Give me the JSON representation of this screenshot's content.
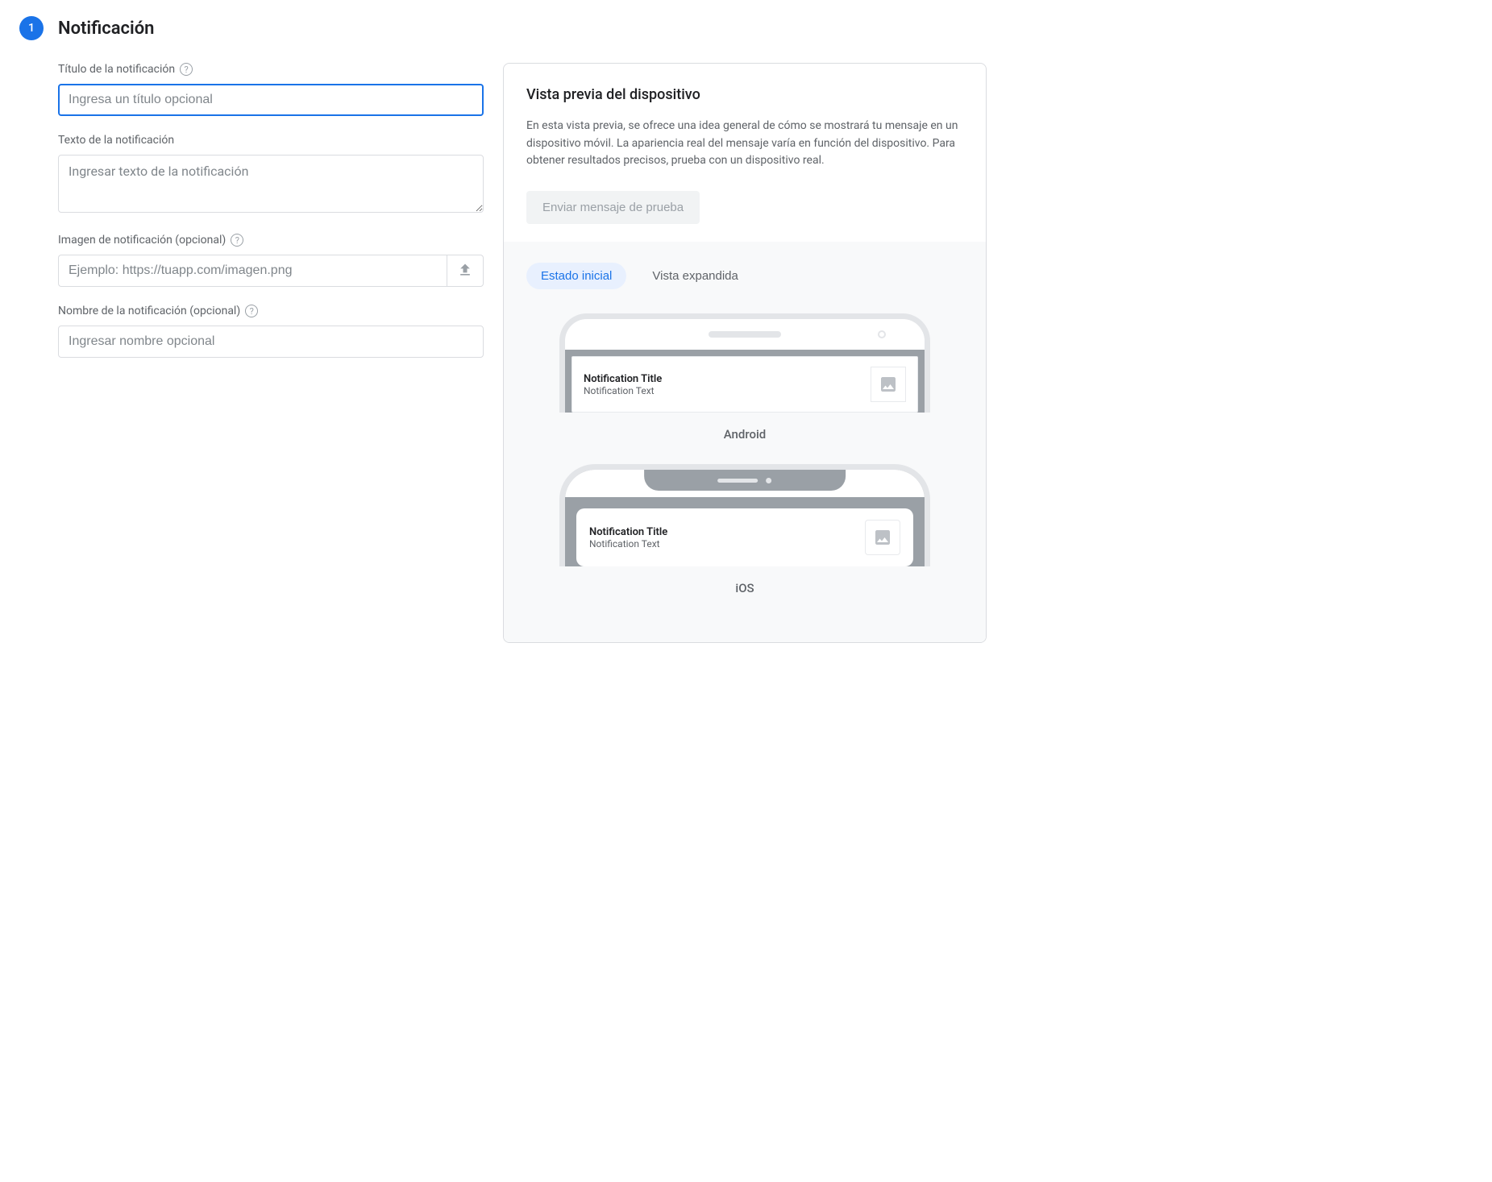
{
  "step": {
    "number": "1",
    "title": "Notificación"
  },
  "fields": {
    "title": {
      "label": "Título de la notificación",
      "placeholder": "Ingresa un título opcional"
    },
    "text": {
      "label": "Texto de la notificación",
      "placeholder": "Ingresar texto de la notificación"
    },
    "image": {
      "label": "Imagen de notificación (opcional)",
      "placeholder": "Ejemplo: https://tuapp.com/imagen.png"
    },
    "name": {
      "label": "Nombre de la notificación (opcional)",
      "placeholder": "Ingresar nombre opcional"
    }
  },
  "preview": {
    "heading": "Vista previa del dispositivo",
    "description": "En esta vista previa, se ofrece una idea general de cómo se mostrará tu mensaje en un dispositivo móvil. La apariencia real del mensaje varía en función del dispositivo. Para obtener resultados precisos, prueba con un dispositivo real.",
    "test_button": "Enviar mensaje de prueba",
    "tabs": {
      "initial": "Estado inicial",
      "expanded": "Vista expandida"
    },
    "notif": {
      "title": "Notification Title",
      "text": "Notification Text"
    },
    "os": {
      "android": "Android",
      "ios": "iOS"
    }
  }
}
